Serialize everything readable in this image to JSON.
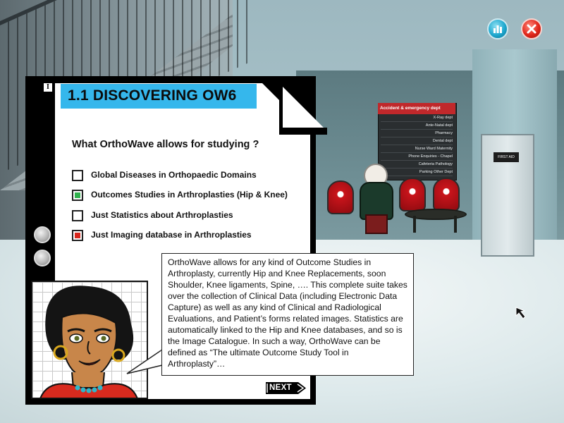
{
  "title": "1.1 DISCOVERING OW6",
  "info_glyph": "I",
  "question": "What OrthoWave allows for studying ?",
  "options": [
    {
      "label": "Global Diseases in Orthopaedic Domains",
      "state": "empty"
    },
    {
      "label": "Outcomes Studies in Arthroplasties (Hip & Knee)",
      "state": "correct"
    },
    {
      "label": "Just Statistics about Arthroplasties",
      "state": "empty"
    },
    {
      "label": "Just Imaging database in Arthroplasties",
      "state": "wrong"
    }
  ],
  "explanation": "OrthoWave allows for any kind of Outcome Studies in Arthroplasty, currently Hip and Knee Replacements, soon Shoulder, Knee ligaments, Spine, …. This complete suite takes over the collection of Clinical Data (including Electronic Data Capture) as well as any kind of Clinical and Radiological Evaluations, and Patient’s forms related images. Statistics are automatically linked to the Hip and Knee databases, and so is the Image Catalogue. In such a way, OrthoWave can be defined as “The ultimate Outcome Study Tool in Arthroplasty”…",
  "next_label": "NEXT",
  "toolbar": {
    "stats_icon": "bar-chart-icon",
    "close_icon": "close-icon"
  },
  "signage": {
    "header": "Accident & emergency dept",
    "rows": [
      "X-Ray dept",
      "Ante-Natal dept",
      "Pharmacy",
      "Dental dept",
      "Nurse Ward    Maternity",
      "Phone   Enquiries - Chapel",
      "Cafeteria   Pathology",
      "Parking    Other Dept"
    ],
    "door_sign": "FIRST AID"
  },
  "colors": {
    "title_bar": "#35b7ec",
    "correct": "#2fb14c",
    "wrong": "#d8261c",
    "card": "#000000",
    "stats_button": "#1ea8cf",
    "close_button": "#e0261a"
  }
}
